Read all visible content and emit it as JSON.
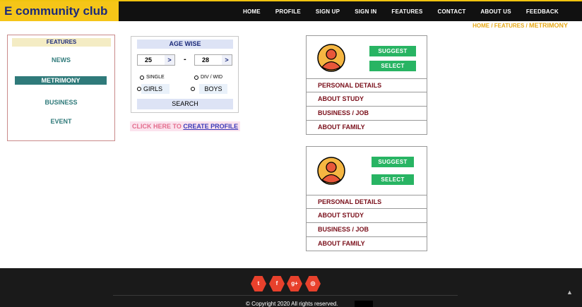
{
  "brand": "E community club",
  "nav": [
    "HOME",
    "PROFILE",
    "SIGN UP",
    "SIGN IN",
    "FEATURES",
    "CONTACT",
    "ABOUT US",
    "FEEDBACK"
  ],
  "breadcrumb": {
    "home": "HOME",
    "sep": " / ",
    "features": "FEATURES",
    "current": "METRIMONY"
  },
  "features": {
    "title": "FEATURES",
    "items": [
      "NEWS",
      "METRIMONY",
      "BUSINESS",
      "EVENT"
    ]
  },
  "age": {
    "title": "AGE WISE",
    "from": "25",
    "to": "28",
    "arrow": ">",
    "dash": "-",
    "status": [
      "SINGLE",
      "DIV / WID"
    ],
    "gender": [
      "GIRLS",
      "BOYS"
    ],
    "search": "SEARCH"
  },
  "create": {
    "prefix": "CLICK HERE TO ",
    "link": "CREATE PROFILE"
  },
  "cards": [
    {
      "suggest": "SUGGEST",
      "select": "SELECT",
      "rows": [
        "PERSONAL DETAILS",
        "ABOUT STUDY",
        "BUSINESS / JOB",
        "ABOUT FAMILY"
      ]
    },
    {
      "suggest": "SUGGEST",
      "select": "SELECT",
      "rows": [
        "PERSONAL DETAILS",
        "ABOUT STUDY",
        "BUSINESS / JOB",
        "ABOUT FAMILY"
      ]
    }
  ],
  "footer": {
    "social": [
      "twitter-icon",
      "facebook-icon",
      "google-plus-icon",
      "instagram-icon"
    ],
    "copyright": "© Copyright 2020 All rights reserved."
  },
  "colors": {
    "brand_bg": "#f5c518",
    "nav_bg": "#111111",
    "accent_green": "#28b463",
    "teal": "#2f7a7a",
    "maroon": "#7a0f1a",
    "social_red": "#e8412c"
  }
}
